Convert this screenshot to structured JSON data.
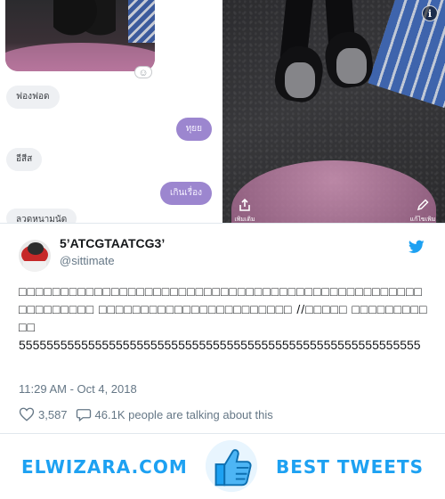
{
  "media": {
    "chat_bubbles": [
      {
        "text": "ฟองฟอด",
        "side": "in"
      },
      {
        "text": "ทุยย",
        "side": "out"
      },
      {
        "text": "อีสีส",
        "side": "in"
      },
      {
        "text": "เกินเรื่อง",
        "side": "out"
      },
      {
        "text": "ลวดหนามนัด",
        "side": "in"
      }
    ],
    "info_icon": "info-icon",
    "share_label": "เพิ่มเติม",
    "edit_label": "แก้ไขเพิ่ม"
  },
  "tweet": {
    "display_name": "5’ATCGTAATCG3’",
    "handle": "@sittimate",
    "text_thai_line": "□□□□□□□□□□□□□□□□□□□□□□□□□□□□□□□□□□□□□□□□□□□□□□□□□□□□□□□□□ □□□□□□□□□□□□□□□□□□□□□□□ //□□□□□ □□□□□□□□□□□",
    "text_laugh": "5555555555555555555555555555555555555555555555555555555555",
    "timestamp": "11:29 AM - Oct 4, 2018",
    "like_count": "3,587",
    "talking_text": "46.1K people are talking about this"
  },
  "footer": {
    "brand": "ELWIZARA.COM",
    "tagline": "BEST TWEETS"
  },
  "colors": {
    "twitter_blue": "#1da1f2",
    "meta_gray": "#657786",
    "bubble_out": "#9c86cf",
    "bubble_in": "#eef0f3"
  }
}
